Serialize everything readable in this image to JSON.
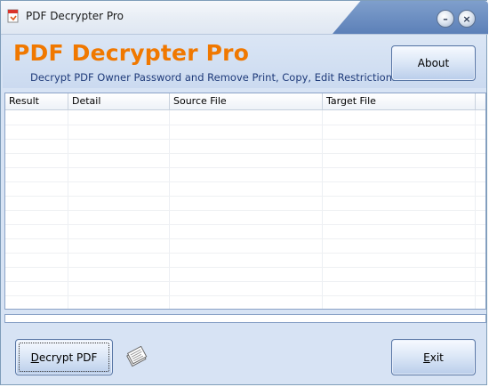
{
  "window": {
    "title": "PDF Decrypter Pro",
    "minimize_glyph": "–",
    "close_glyph": "×"
  },
  "header": {
    "app_title": "PDF Decrypter Pro",
    "subtitle": "Decrypt PDF Owner Password and Remove Print, Copy, Edit  Restrictions.",
    "about_label": "About"
  },
  "table": {
    "columns": [
      "Result",
      "Detail",
      "Source File",
      "Target File"
    ],
    "rows": []
  },
  "progress": {
    "value": 0
  },
  "footer": {
    "decrypt_label_first": "D",
    "decrypt_label_rest": "ecrypt PDF",
    "exit_label_first": "E",
    "exit_label_rest": "xit"
  },
  "colors": {
    "title_orange": "#f07800",
    "subtitle_blue": "#1f3b7a",
    "window_bg": "#d7e3f4",
    "accent_blue": "#5c80b8"
  },
  "icons": {
    "app_icon": "pdf-file-icon",
    "docs_icon": "documents-stack-icon"
  }
}
